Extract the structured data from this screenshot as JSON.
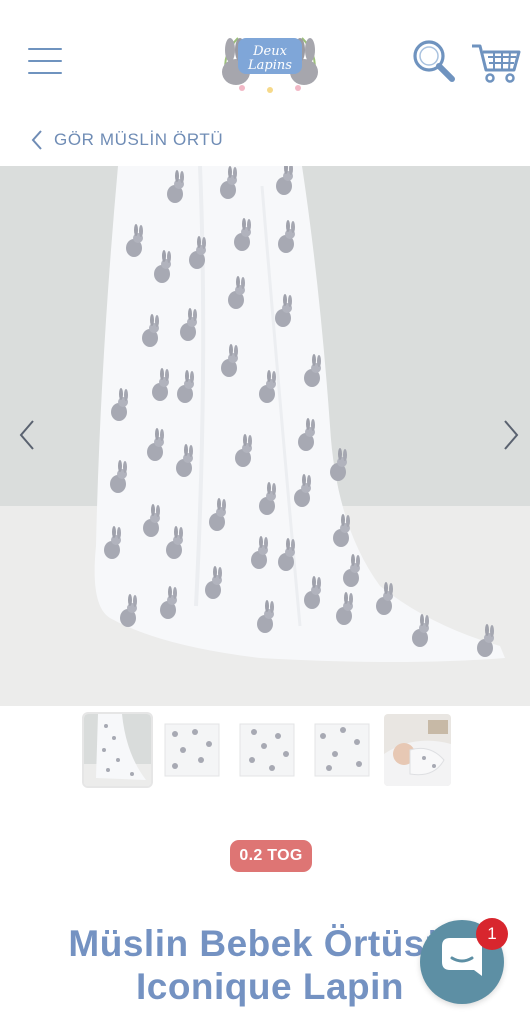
{
  "header": {
    "logo_text_line1": "Deux",
    "logo_text_line2": "Lapins",
    "menu_icon": "hamburger-icon",
    "search_icon": "search-icon",
    "cart_icon": "cart-icon"
  },
  "breadcrumb": {
    "label": "GÖR MÜSLİN ÖRTÜ"
  },
  "gallery": {
    "prev_icon": "chevron-left-icon",
    "next_icon": "chevron-right-icon",
    "thumbnails": [
      {
        "name": "thumb-draped",
        "active": true
      },
      {
        "name": "thumb-flat-1",
        "active": false
      },
      {
        "name": "thumb-flat-2",
        "active": false
      },
      {
        "name": "thumb-flat-3",
        "active": false
      },
      {
        "name": "thumb-baby",
        "active": false
      }
    ]
  },
  "product": {
    "badge": "0.2 TOG",
    "title": "Müslin Bebek Örtüsü - Iconique Lapin"
  },
  "chat": {
    "icon": "chat-icon",
    "unread_count": "1"
  },
  "colors": {
    "brand_blue": "#6f93bf",
    "badge_red": "#de7574",
    "chat_teal": "#5d8fa4",
    "notification_red": "#d8262e"
  }
}
